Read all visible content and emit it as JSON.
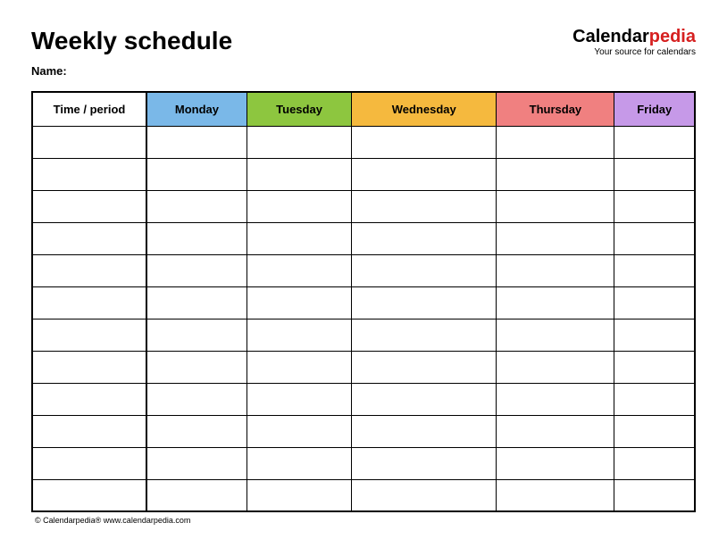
{
  "title": "Weekly schedule",
  "name_label": "Name:",
  "logo": {
    "part1": "Calendar",
    "part2": "pedia",
    "tagline": "Your source for calendars"
  },
  "columns": {
    "time": "Time / period",
    "days": [
      "Monday",
      "Tuesday",
      "Wednesday",
      "Thursday",
      "Friday"
    ]
  },
  "rows": 12,
  "footer": "© Calendarpedia®   www.calendarpedia.com",
  "colors": {
    "monday": "#7ab8e8",
    "tuesday": "#8dc63f",
    "wednesday": "#f5b93e",
    "thursday": "#f08080",
    "friday": "#c699e8"
  }
}
